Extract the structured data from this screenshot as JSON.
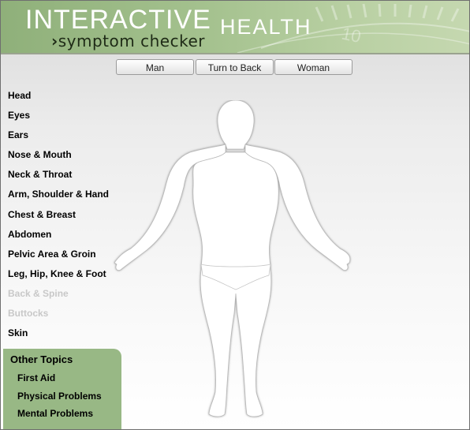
{
  "brand": {
    "main": "INTERACTIVE",
    "sub": "HEALTH",
    "tagline_chevron": "›",
    "tagline": "symptom checker",
    "gauge_number": "10"
  },
  "view_buttons": [
    {
      "label": "Man"
    },
    {
      "label": "Turn to Back"
    },
    {
      "label": "Woman"
    }
  ],
  "body_areas": [
    {
      "label": "Head",
      "enabled": true
    },
    {
      "label": "Eyes",
      "enabled": true
    },
    {
      "label": "Ears",
      "enabled": true
    },
    {
      "label": "Nose & Mouth",
      "enabled": true
    },
    {
      "label": "Neck & Throat",
      "enabled": true
    },
    {
      "label": "Arm, Shoulder & Hand",
      "enabled": true
    },
    {
      "label": "Chest & Breast",
      "enabled": true
    },
    {
      "label": "Abdomen",
      "enabled": true
    },
    {
      "label": "Pelvic Area & Groin",
      "enabled": true
    },
    {
      "label": "Leg, Hip, Knee & Foot",
      "enabled": true
    },
    {
      "label": "Back & Spine",
      "enabled": false
    },
    {
      "label": "Buttocks",
      "enabled": false
    },
    {
      "label": "Skin",
      "enabled": true
    }
  ],
  "other_topics": {
    "title": "Other Topics",
    "items": [
      {
        "label": "First Aid"
      },
      {
        "label": "Physical Problems"
      },
      {
        "label": "Mental Problems"
      }
    ]
  },
  "colors": {
    "banner_green": "#a5c28f",
    "panel_green": "#98b885",
    "disabled_text": "#c8c8c8"
  }
}
